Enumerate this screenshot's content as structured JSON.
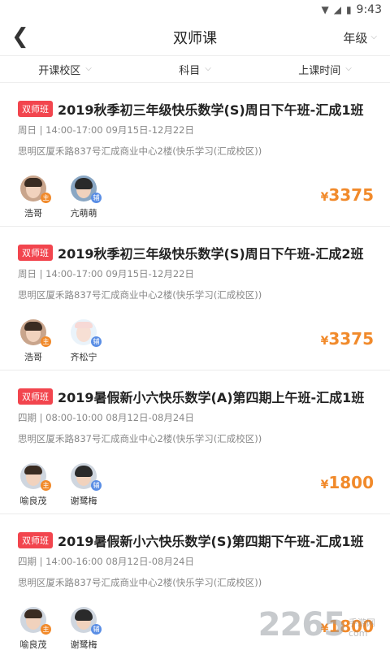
{
  "status_bar": {
    "time": "9:43",
    "icons": [
      "wifi-icon",
      "signal-icon",
      "battery-icon"
    ]
  },
  "header": {
    "title": "双师课",
    "grade_label": "年级"
  },
  "filters": [
    {
      "label": "开课校区"
    },
    {
      "label": "科目"
    },
    {
      "label": "上课时间"
    }
  ],
  "courses": [
    {
      "badge": "双师班",
      "title": "2019秋季初三年级快乐数学(S)周日下午班-汇成1班",
      "schedule": "周日 | 14:00-17:00 09月15日-12月22日",
      "address": "思明区厦禾路837号汇成商业中心2楼(快乐学习(汇成校区))",
      "teachers": [
        {
          "name": "浩哥",
          "role": "主"
        },
        {
          "name": "亢萌萌",
          "role": "辅"
        }
      ],
      "price_symbol": "¥",
      "price": "3375"
    },
    {
      "badge": "双师班",
      "title": "2019秋季初三年级快乐数学(S)周日下午班-汇成2班",
      "schedule": "周日 | 14:00-17:00 09月15日-12月22日",
      "address": "思明区厦禾路837号汇成商业中心2楼(快乐学习(汇成校区))",
      "teachers": [
        {
          "name": "浩哥",
          "role": "主"
        },
        {
          "name": "齐松宁",
          "role": "辅"
        }
      ],
      "price_symbol": "¥",
      "price": "3375"
    },
    {
      "badge": "双师班",
      "title": "2019暑假新小六快乐数学(A)第四期上午班-汇成1班",
      "schedule": "四期 | 08:00-10:00 08月12日-08月24日",
      "address": "思明区厦禾路837号汇成商业中心2楼(快乐学习(汇成校区))",
      "teachers": [
        {
          "name": "喻良茂",
          "role": "主"
        },
        {
          "name": "谢鹭梅",
          "role": "辅"
        }
      ],
      "price_symbol": "¥",
      "price": "1800"
    },
    {
      "badge": "双师班",
      "title": "2019暑假新小六快乐数学(S)第四期下午班-汇成1班",
      "schedule": "四期 | 14:00-16:00 08月12日-08月24日",
      "address": "思明区厦禾路837号汇成商业中心2楼(快乐学习(汇成校区))",
      "teachers": [
        {
          "name": "喻良茂",
          "role": "主"
        },
        {
          "name": "谢鹭梅",
          "role": "辅"
        }
      ],
      "price_symbol": "¥",
      "price": "1800"
    }
  ],
  "watermark": {
    "number": "2265",
    "text_top": "手游网",
    "text_bottom": "com"
  },
  "colors": {
    "badge": "#f2454e",
    "price": "#f18a2b",
    "role_main": "#f18a2b",
    "role_assist": "#5a8ee5"
  }
}
